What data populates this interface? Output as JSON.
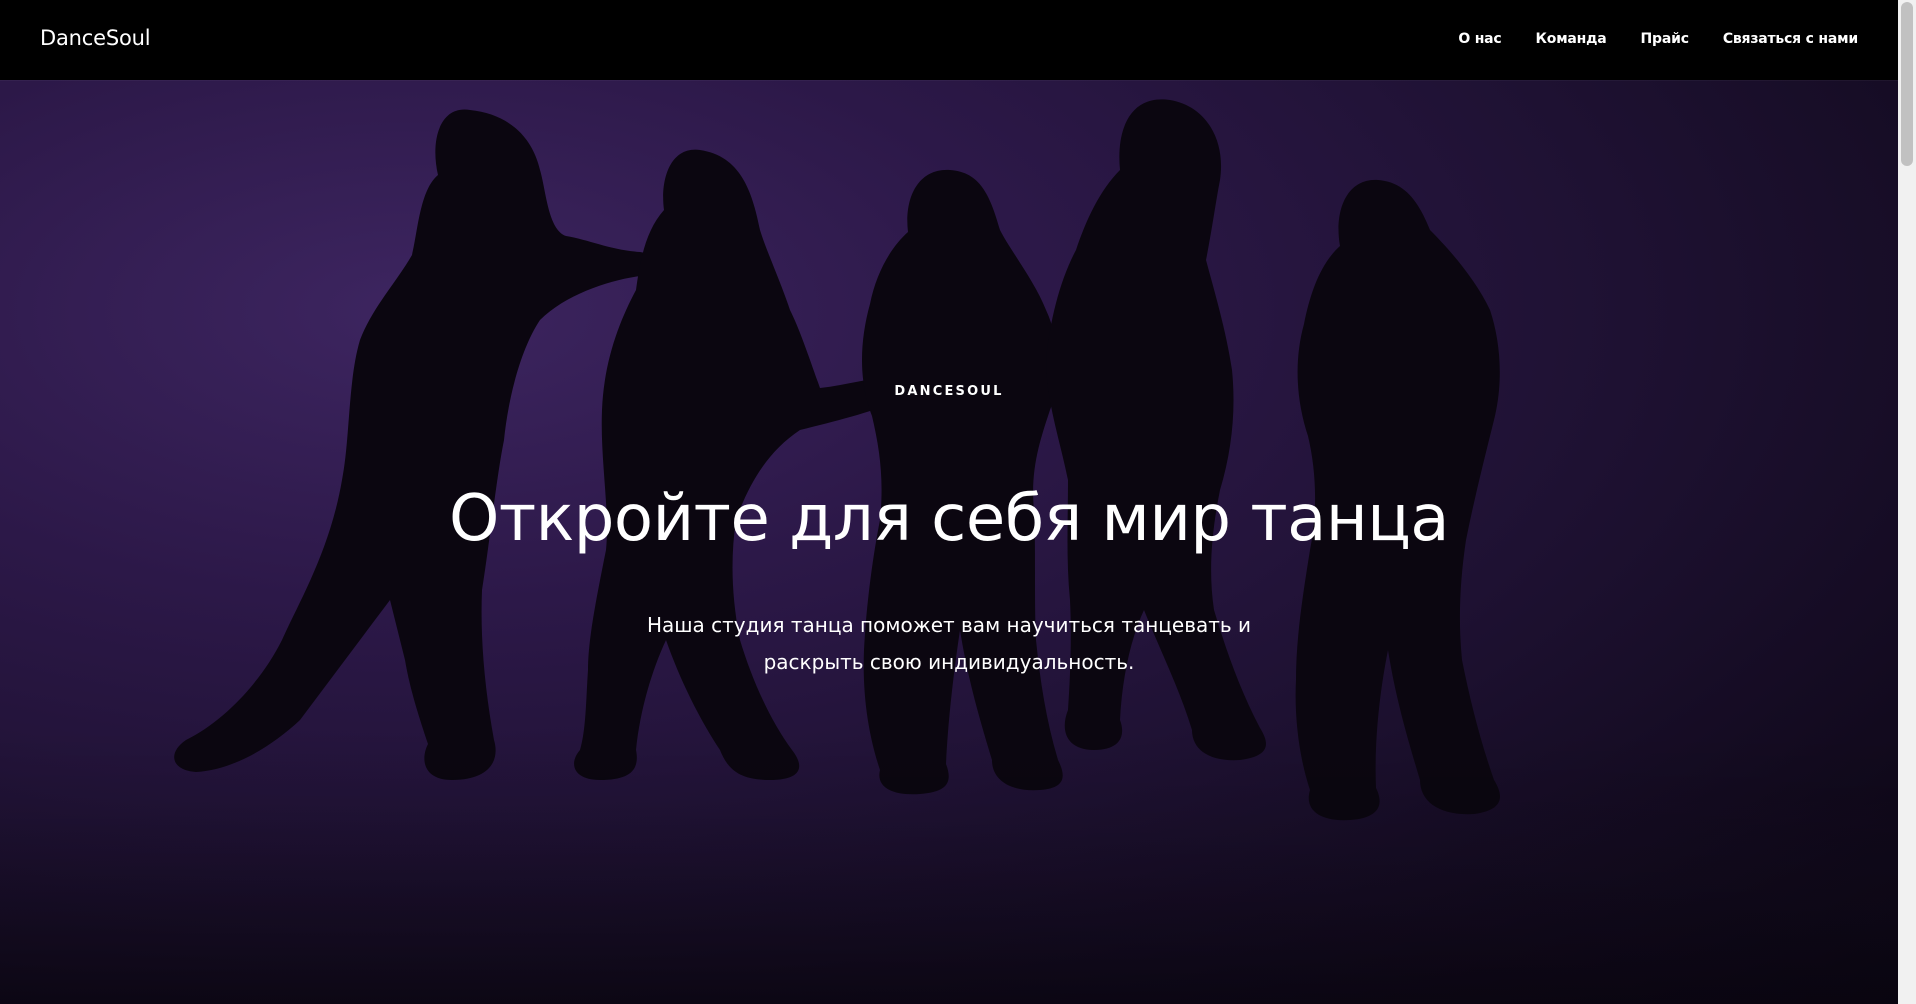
{
  "header": {
    "brand": "DanceSoul",
    "nav": [
      {
        "label": "О нас"
      },
      {
        "label": "Команда"
      },
      {
        "label": "Прайс"
      },
      {
        "label": "Связаться с нами"
      }
    ]
  },
  "hero": {
    "eyebrow": "DANCESOUL",
    "title": "Откройте для себя мир танца",
    "subtitle": "Наша студия танца поможет вам научиться танцевать и раскрыть свою индивидуальность.",
    "background_image": "silhouettes of five dancers against a purple backdrop"
  },
  "colors": {
    "header_bg": "#000000",
    "hero_bg": "#2c1848",
    "text": "#ffffff"
  }
}
